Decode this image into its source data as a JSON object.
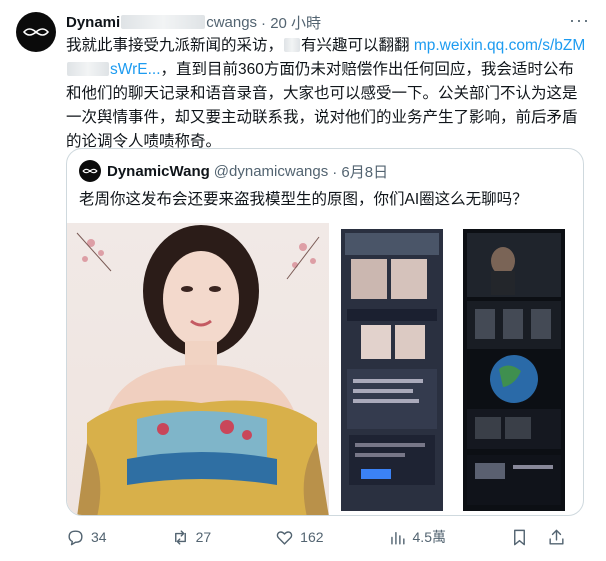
{
  "tweet": {
    "name_visible": "Dynami",
    "handle_visible": "cwangs",
    "time": "· 20 小時",
    "more": "···",
    "text_part1": "我就此事接受九派新闻的采访，",
    "text_part2": "有兴趣可以翻翻",
    "link": "mp.weixin.qq.com/s/bZM",
    "link_end": "sWrE...",
    "text_part3": "，直到目前360方面仍未对赔偿作出任何回应，我会适时公布和他们的聊天记录和语音录音，大家也可以感受一下。公关部门不认为这是一次舆情事件，却又要主动联系我，说对他们的业务产生了影响，前后矛盾的论调令人啧啧称奇。"
  },
  "quote": {
    "name": "DynamicWang",
    "handle": "@dynamicwangs",
    "date": "· 6月8日",
    "text": "老周你这发布会还要来盗我模型生的原图，你们AI圈这么无聊吗？"
  },
  "actions": {
    "replies": "34",
    "retweets": "27",
    "likes": "162",
    "views": "4.5萬"
  },
  "icons": [
    "logo-icon",
    "reply-icon",
    "retweet-icon",
    "like-icon",
    "views-icon",
    "bookmark-icon",
    "share-icon"
  ]
}
